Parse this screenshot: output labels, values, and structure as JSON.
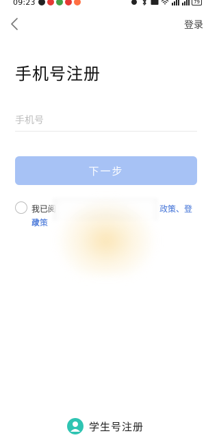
{
  "status_bar": {
    "time": "09:23",
    "battery": "79"
  },
  "header": {
    "login_label": "登录"
  },
  "page": {
    "title": "手机号注册"
  },
  "form": {
    "phone_placeholder": "手机号",
    "next_label": "下一步"
  },
  "agreement": {
    "text_prefix": "我已阅",
    "text_visible_links": "政策、登录",
    "text_line2": "政策"
  },
  "footer": {
    "student_register_label": "学生号注册"
  },
  "colors": {
    "accent": "#a7c2f5",
    "link": "#3d6fd6",
    "student_icon": "#2fc4b2"
  }
}
